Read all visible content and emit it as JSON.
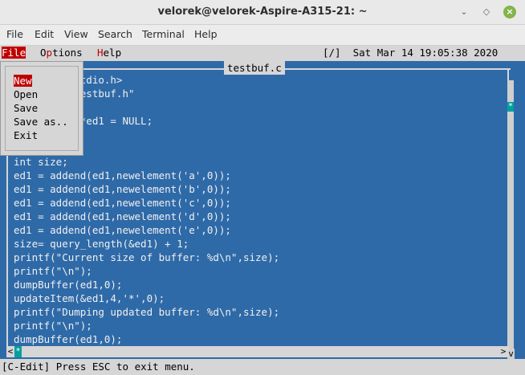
{
  "window": {
    "title": "velorek@velorek-Aspire-A315-21: ~",
    "min_glyph": "⌄",
    "max_glyph": "◇",
    "close_glyph": "×",
    "close_color": "#82b54a"
  },
  "gnome_menu": [
    "File",
    "Edit",
    "View",
    "Search",
    "Terminal",
    "Help"
  ],
  "tui_menu": {
    "file": {
      "hot": "F",
      "rest": "ile"
    },
    "options": {
      "pre": "O",
      "hot": "p",
      "rest": "tions"
    },
    "help": {
      "hot": "H",
      "rest": "elp"
    }
  },
  "status": "[/]  Sat Mar 14 19:05:38 2020",
  "filename": "testbuf.c",
  "code_lines": [
    "#include <stdio.h>",
    "#include \"testbuf.h\"",
    "",
    "EDITBUFFER *ed1 = NULL;",
    "",
    "int main(){",
    "int size;",
    "ed1 = addend(ed1,newelement('a',0));",
    "ed1 = addend(ed1,newelement('b',0));",
    "ed1 = addend(ed1,newelement('c',0));",
    "ed1 = addend(ed1,newelement('d',0));",
    "ed1 = addend(ed1,newelement('e',0));",
    "size= query_length(&ed1) + 1;",
    "printf(\"Current size of buffer: %d\\n\",size);",
    "printf(\"\\n\");",
    "dumpBuffer(ed1,0);",
    "updateItem(&ed1,4,'*',0);",
    "printf(\"Dumping updated buffer: %d\\n\",size);",
    "printf(\"\\n\");",
    "dumpBuffer(ed1,0);"
  ],
  "dropdown": [
    "New",
    "Open",
    "Save",
    "Save as..",
    "Exit"
  ],
  "scroll": {
    "thumb": "*",
    "v_end": "v",
    "h_left": "<",
    "h_right": ">"
  },
  "bottom_status": "[C-Edit] Press ESC to exit menu.",
  "colors": {
    "editor_bg": "#2f6aa8",
    "menu_hot": "#c00000",
    "scroll_thumb": "#00a0a0"
  }
}
